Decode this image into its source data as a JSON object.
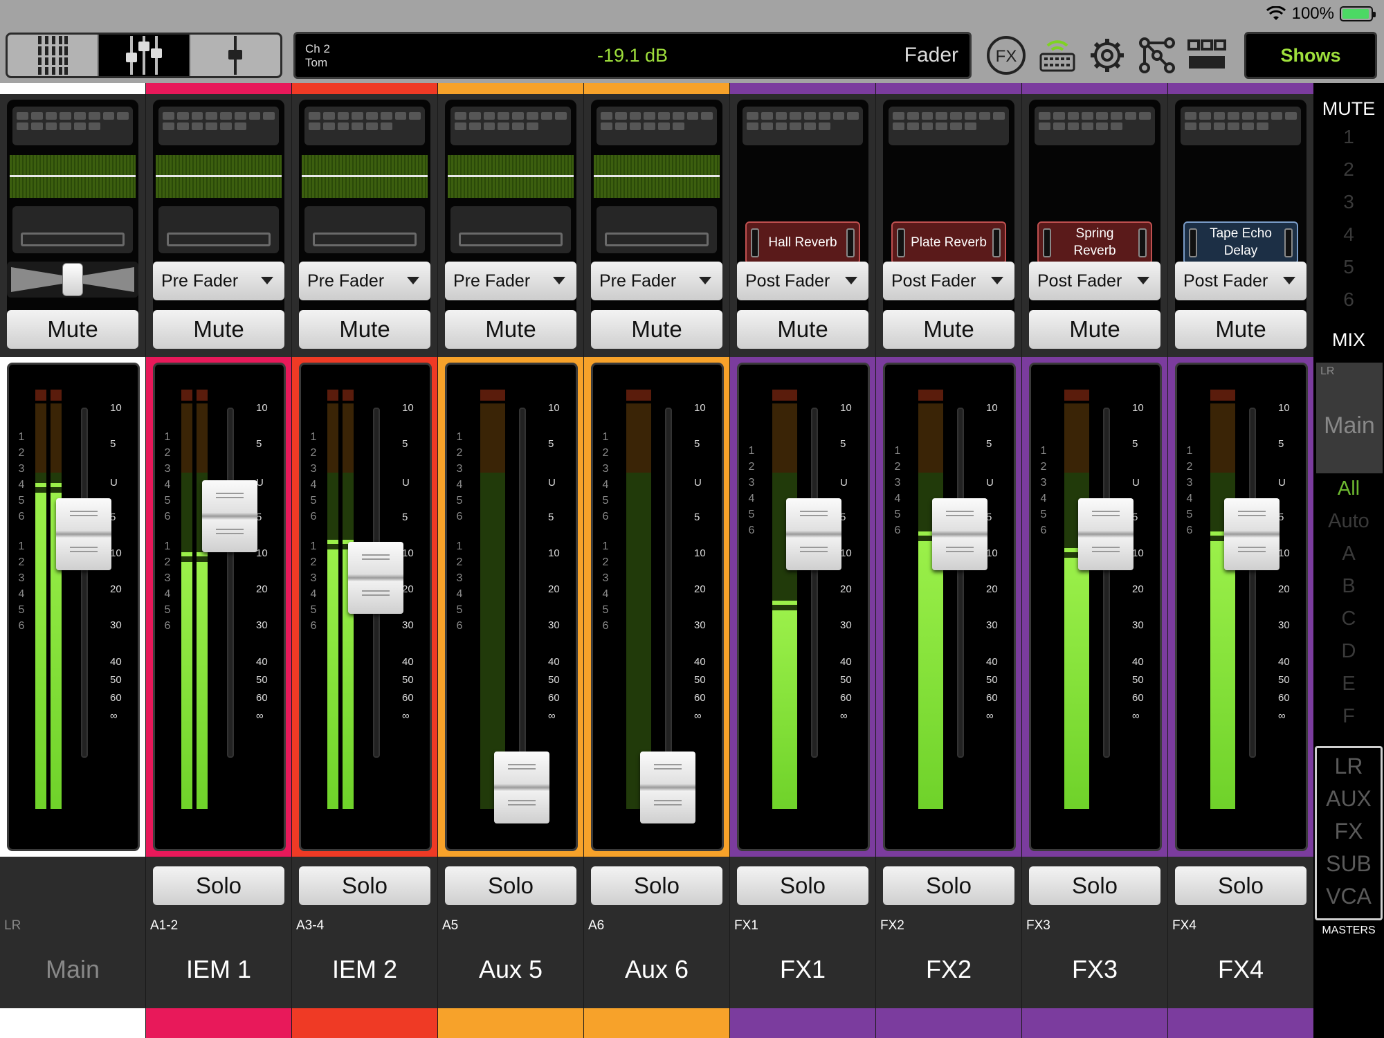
{
  "status": {
    "battery_pct": "100%"
  },
  "colors": {
    "accent_green": "#9fe03c",
    "white": "#ffffff",
    "pink": "#e8195a",
    "red": "#ef3a25",
    "orange": "#f7a22a",
    "purple": "#7b3c9e"
  },
  "toolbar": {
    "views": [
      {
        "icon": "channel-grid-icon"
      },
      {
        "icon": "mixer-faders-icon",
        "active": true
      },
      {
        "icon": "single-fader-icon"
      }
    ],
    "display": {
      "channel": "Ch 2",
      "channel_name": "Tom",
      "value": "-19.1 dB",
      "mode": "Fader"
    },
    "icons": [
      "fx-icon",
      "wifi-keyboard-icon",
      "gear-icon",
      "patch-icon",
      "layout-icon"
    ],
    "fx_label": "FX",
    "shows_label": "Shows"
  },
  "strips": [
    {
      "id": "main",
      "color": "#ffffff",
      "route": "pan",
      "mute": "Mute",
      "solo": "",
      "subtag": "LR",
      "name": "Main",
      "fader_level": 0.16,
      "has_clip_pairs": true,
      "meter_levels": [
        0.78,
        0.78
      ]
    },
    {
      "id": "iem1",
      "color": "#e8195a",
      "route": "Pre Fader",
      "mute": "Mute",
      "solo": "Solo",
      "subtag": "A1-2",
      "name": "IEM 1",
      "fader_level": 0.1,
      "has_clip_pairs": true,
      "meter_levels": [
        0.61,
        0.61
      ]
    },
    {
      "id": "iem2",
      "color": "#ef3a25",
      "route": "Pre Fader",
      "mute": "Mute",
      "solo": "Solo",
      "subtag": "A3-4",
      "name": "IEM 2",
      "fader_level": 0.3,
      "has_clip_pairs": true,
      "meter_levels": [
        0.64,
        0.64
      ]
    },
    {
      "id": "aux5",
      "color": "#f7a22a",
      "route": "Pre Fader",
      "mute": "Mute",
      "solo": "Solo",
      "subtag": "A5",
      "name": "Aux 5",
      "fader_level": 0.98,
      "has_clip_pairs": false,
      "meter_levels": [
        0.0
      ]
    },
    {
      "id": "aux6",
      "color": "#f7a22a",
      "route": "Pre Fader",
      "mute": "Mute",
      "solo": "Solo",
      "subtag": "A6",
      "name": "Aux 6",
      "fader_level": 0.98,
      "has_clip_pairs": false,
      "meter_levels": [
        0.0
      ]
    },
    {
      "id": "fx1",
      "color": "#7b3c9e",
      "route": "Post Fader",
      "fx": "Hall Reverb",
      "fx_style": "red",
      "mute": "Mute",
      "solo": "Solo",
      "subtag": "FX1",
      "name": "FX1",
      "fader_level": 0.16,
      "has_clip_pairs": false,
      "meter_levels": [
        0.49
      ]
    },
    {
      "id": "fx2",
      "color": "#7b3c9e",
      "route": "Post Fader",
      "fx": "Plate Reverb",
      "fx_style": "red",
      "mute": "Mute",
      "solo": "Solo",
      "subtag": "FX2",
      "name": "FX2",
      "fader_level": 0.16,
      "has_clip_pairs": false,
      "meter_levels": [
        0.66
      ]
    },
    {
      "id": "fx3",
      "color": "#7b3c9e",
      "route": "Post Fader",
      "fx": "Spring Reverb",
      "fx_style": "red",
      "mute": "Mute",
      "solo": "Solo",
      "subtag": "FX3",
      "name": "FX3",
      "fader_level": 0.16,
      "has_clip_pairs": false,
      "meter_levels": [
        0.62
      ]
    },
    {
      "id": "fx4",
      "color": "#7b3c9e",
      "route": "Post Fader",
      "fx": "Tape Echo Delay",
      "fx_style": "blue",
      "mute": "Mute",
      "solo": "Solo",
      "subtag": "FX4",
      "name": "FX4",
      "fader_level": 0.16,
      "has_clip_pairs": false,
      "meter_levels": [
        0.66
      ]
    }
  ],
  "scale_ticks": [
    "10",
    "5",
    "U",
    "5",
    "10",
    "20",
    "30",
    "40",
    "50",
    "60",
    "∞"
  ],
  "meter_numbers": [
    "1",
    "2",
    "3",
    "4",
    "5",
    "6"
  ],
  "rail": {
    "mute_header": "MUTE",
    "mute_groups": [
      "1",
      "2",
      "3",
      "4",
      "5",
      "6"
    ],
    "mix_header": "MIX",
    "mix_lr": "LR",
    "mix_main": "Main",
    "groups": [
      "All",
      "Auto",
      "A",
      "B",
      "C",
      "D",
      "E",
      "F"
    ],
    "masters": [
      "LR",
      "AUX",
      "FX",
      "SUB",
      "VCA"
    ],
    "masters_label": "MASTERS"
  }
}
